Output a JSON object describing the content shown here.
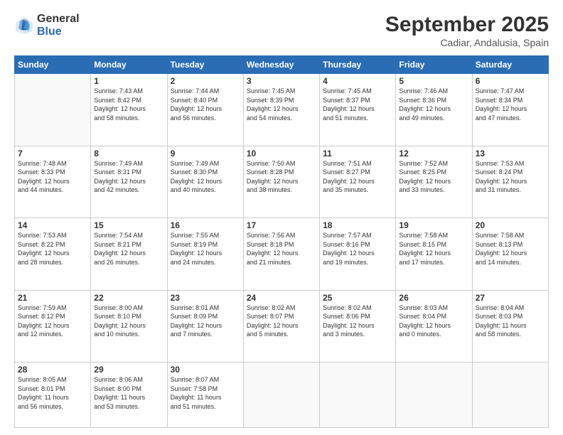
{
  "logo": {
    "general": "General",
    "blue": "Blue"
  },
  "header": {
    "month": "September 2025",
    "location": "Cadiar, Andalusia, Spain"
  },
  "weekdays": [
    "Sunday",
    "Monday",
    "Tuesday",
    "Wednesday",
    "Thursday",
    "Friday",
    "Saturday"
  ],
  "weeks": [
    [
      {
        "day": "",
        "info": ""
      },
      {
        "day": "1",
        "info": "Sunrise: 7:43 AM\nSunset: 8:42 PM\nDaylight: 12 hours\nand 58 minutes."
      },
      {
        "day": "2",
        "info": "Sunrise: 7:44 AM\nSunset: 8:40 PM\nDaylight: 12 hours\nand 56 minutes."
      },
      {
        "day": "3",
        "info": "Sunrise: 7:45 AM\nSunset: 8:39 PM\nDaylight: 12 hours\nand 54 minutes."
      },
      {
        "day": "4",
        "info": "Sunrise: 7:45 AM\nSunset: 8:37 PM\nDaylight: 12 hours\nand 51 minutes."
      },
      {
        "day": "5",
        "info": "Sunrise: 7:46 AM\nSunset: 8:36 PM\nDaylight: 12 hours\nand 49 minutes."
      },
      {
        "day": "6",
        "info": "Sunrise: 7:47 AM\nSunset: 8:34 PM\nDaylight: 12 hours\nand 47 minutes."
      }
    ],
    [
      {
        "day": "7",
        "info": "Sunrise: 7:48 AM\nSunset: 8:33 PM\nDaylight: 12 hours\nand 44 minutes."
      },
      {
        "day": "8",
        "info": "Sunrise: 7:49 AM\nSunset: 8:31 PM\nDaylight: 12 hours\nand 42 minutes."
      },
      {
        "day": "9",
        "info": "Sunrise: 7:49 AM\nSunset: 8:30 PM\nDaylight: 12 hours\nand 40 minutes."
      },
      {
        "day": "10",
        "info": "Sunrise: 7:50 AM\nSunset: 8:28 PM\nDaylight: 12 hours\nand 38 minutes."
      },
      {
        "day": "11",
        "info": "Sunrise: 7:51 AM\nSunset: 8:27 PM\nDaylight: 12 hours\nand 35 minutes."
      },
      {
        "day": "12",
        "info": "Sunrise: 7:52 AM\nSunset: 8:25 PM\nDaylight: 12 hours\nand 33 minutes."
      },
      {
        "day": "13",
        "info": "Sunrise: 7:53 AM\nSunset: 8:24 PM\nDaylight: 12 hours\nand 31 minutes."
      }
    ],
    [
      {
        "day": "14",
        "info": "Sunrise: 7:53 AM\nSunset: 8:22 PM\nDaylight: 12 hours\nand 28 minutes."
      },
      {
        "day": "15",
        "info": "Sunrise: 7:54 AM\nSunset: 8:21 PM\nDaylight: 12 hours\nand 26 minutes."
      },
      {
        "day": "16",
        "info": "Sunrise: 7:55 AM\nSunset: 8:19 PM\nDaylight: 12 hours\nand 24 minutes."
      },
      {
        "day": "17",
        "info": "Sunrise: 7:56 AM\nSunset: 8:18 PM\nDaylight: 12 hours\nand 21 minutes."
      },
      {
        "day": "18",
        "info": "Sunrise: 7:57 AM\nSunset: 8:16 PM\nDaylight: 12 hours\nand 19 minutes."
      },
      {
        "day": "19",
        "info": "Sunrise: 7:58 AM\nSunset: 8:15 PM\nDaylight: 12 hours\nand 17 minutes."
      },
      {
        "day": "20",
        "info": "Sunrise: 7:58 AM\nSunset: 8:13 PM\nDaylight: 12 hours\nand 14 minutes."
      }
    ],
    [
      {
        "day": "21",
        "info": "Sunrise: 7:59 AM\nSunset: 8:12 PM\nDaylight: 12 hours\nand 12 minutes."
      },
      {
        "day": "22",
        "info": "Sunrise: 8:00 AM\nSunset: 8:10 PM\nDaylight: 12 hours\nand 10 minutes."
      },
      {
        "day": "23",
        "info": "Sunrise: 8:01 AM\nSunset: 8:09 PM\nDaylight: 12 hours\nand 7 minutes."
      },
      {
        "day": "24",
        "info": "Sunrise: 8:02 AM\nSunset: 8:07 PM\nDaylight: 12 hours\nand 5 minutes."
      },
      {
        "day": "25",
        "info": "Sunrise: 8:02 AM\nSunset: 8:06 PM\nDaylight: 12 hours\nand 3 minutes."
      },
      {
        "day": "26",
        "info": "Sunrise: 8:03 AM\nSunset: 8:04 PM\nDaylight: 12 hours\nand 0 minutes."
      },
      {
        "day": "27",
        "info": "Sunrise: 8:04 AM\nSunset: 8:03 PM\nDaylight: 11 hours\nand 58 minutes."
      }
    ],
    [
      {
        "day": "28",
        "info": "Sunrise: 8:05 AM\nSunset: 8:01 PM\nDaylight: 11 hours\nand 56 minutes."
      },
      {
        "day": "29",
        "info": "Sunrise: 8:06 AM\nSunset: 8:00 PM\nDaylight: 11 hours\nand 53 minutes."
      },
      {
        "day": "30",
        "info": "Sunrise: 8:07 AM\nSunset: 7:58 PM\nDaylight: 11 hours\nand 51 minutes."
      },
      {
        "day": "",
        "info": ""
      },
      {
        "day": "",
        "info": ""
      },
      {
        "day": "",
        "info": ""
      },
      {
        "day": "",
        "info": ""
      }
    ]
  ]
}
